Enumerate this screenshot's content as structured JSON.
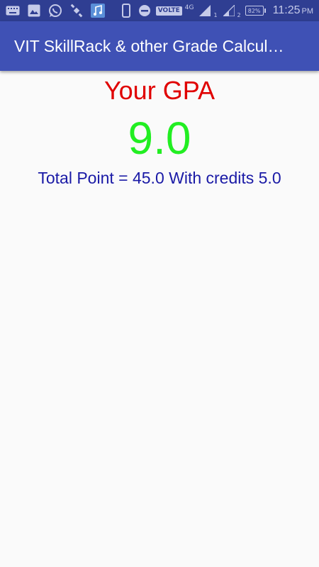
{
  "status_bar": {
    "volte": "VOLTE",
    "network": "4G",
    "sim1": "1",
    "sim2": "2",
    "battery": "82%",
    "time": "11:25",
    "ampm": "PM",
    "icon_color": "#c5cae9",
    "bg_color": "#2f3e92"
  },
  "app_bar": {
    "title": "VIT SkillRack & other Grade Calcul…",
    "bg_color": "#3f51b5"
  },
  "result": {
    "label": "Your GPA",
    "gpa": "9.0",
    "summary": "Total Point = 45.0 With credits 5.0",
    "label_color": "#e00000",
    "gpa_color": "#22ee22",
    "summary_color": "#1a1aa6"
  }
}
